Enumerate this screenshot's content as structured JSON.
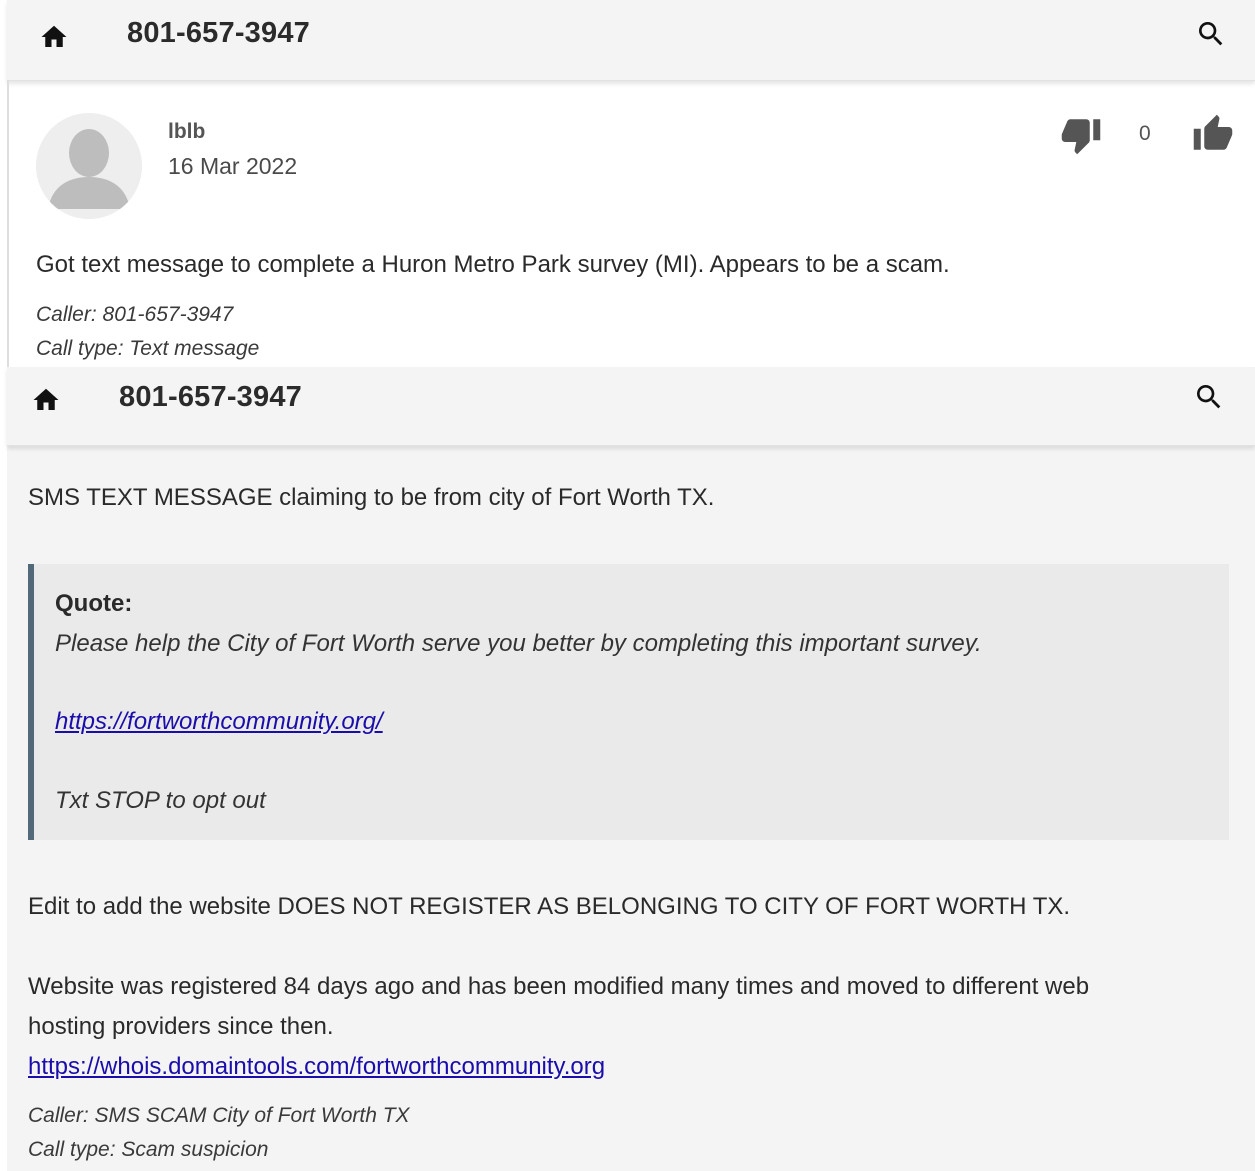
{
  "screens": [
    {
      "header": {
        "title": "801-657-3947"
      },
      "comment": {
        "author": "lblb",
        "date": "16 Mar 2022",
        "votes": "0",
        "text": "Got text message to complete a Huron Metro Park survey (MI). Appears to be a scam.",
        "caller": "Caller: 801-657-3947",
        "call_type": "Call type: Text message"
      }
    },
    {
      "header": {
        "title": "801-657-3947"
      },
      "comment": {
        "intro": "SMS TEXT MESSAGE claiming to be from city of Fort Worth TX.",
        "quote": {
          "label": "Quote:",
          "line": "Please help the City of Fort Worth serve you better by completing this important survey.",
          "link": "https://fortworthcommunity.org/",
          "optout": "Txt STOP to opt out"
        },
        "edit": "Edit to add the website DOES NOT REGISTER AS BELONGING TO CITY OF FORT WORTH TX.",
        "registered_line1": "Website was registered 84 days ago and has been modified many times and moved to different web",
        "registered_line2": "hosting providers since then.",
        "whois_link": "https://whois.domaintools.com/fortworthcommunity.org",
        "caller": "Caller: SMS SCAM City of Fort Worth TX",
        "call_type": "Call type: Scam suspicion"
      }
    }
  ],
  "icons": {
    "home": "home-icon",
    "search": "search-icon",
    "thumb_down": "thumb-down-icon",
    "thumb_up": "thumb-up-icon",
    "avatar": "avatar-placeholder"
  },
  "colors": {
    "header_bg": "#f4f4f4",
    "link": "#1a0dab",
    "quote_bar": "#52697a",
    "quote_bg": "#eaeaea"
  }
}
